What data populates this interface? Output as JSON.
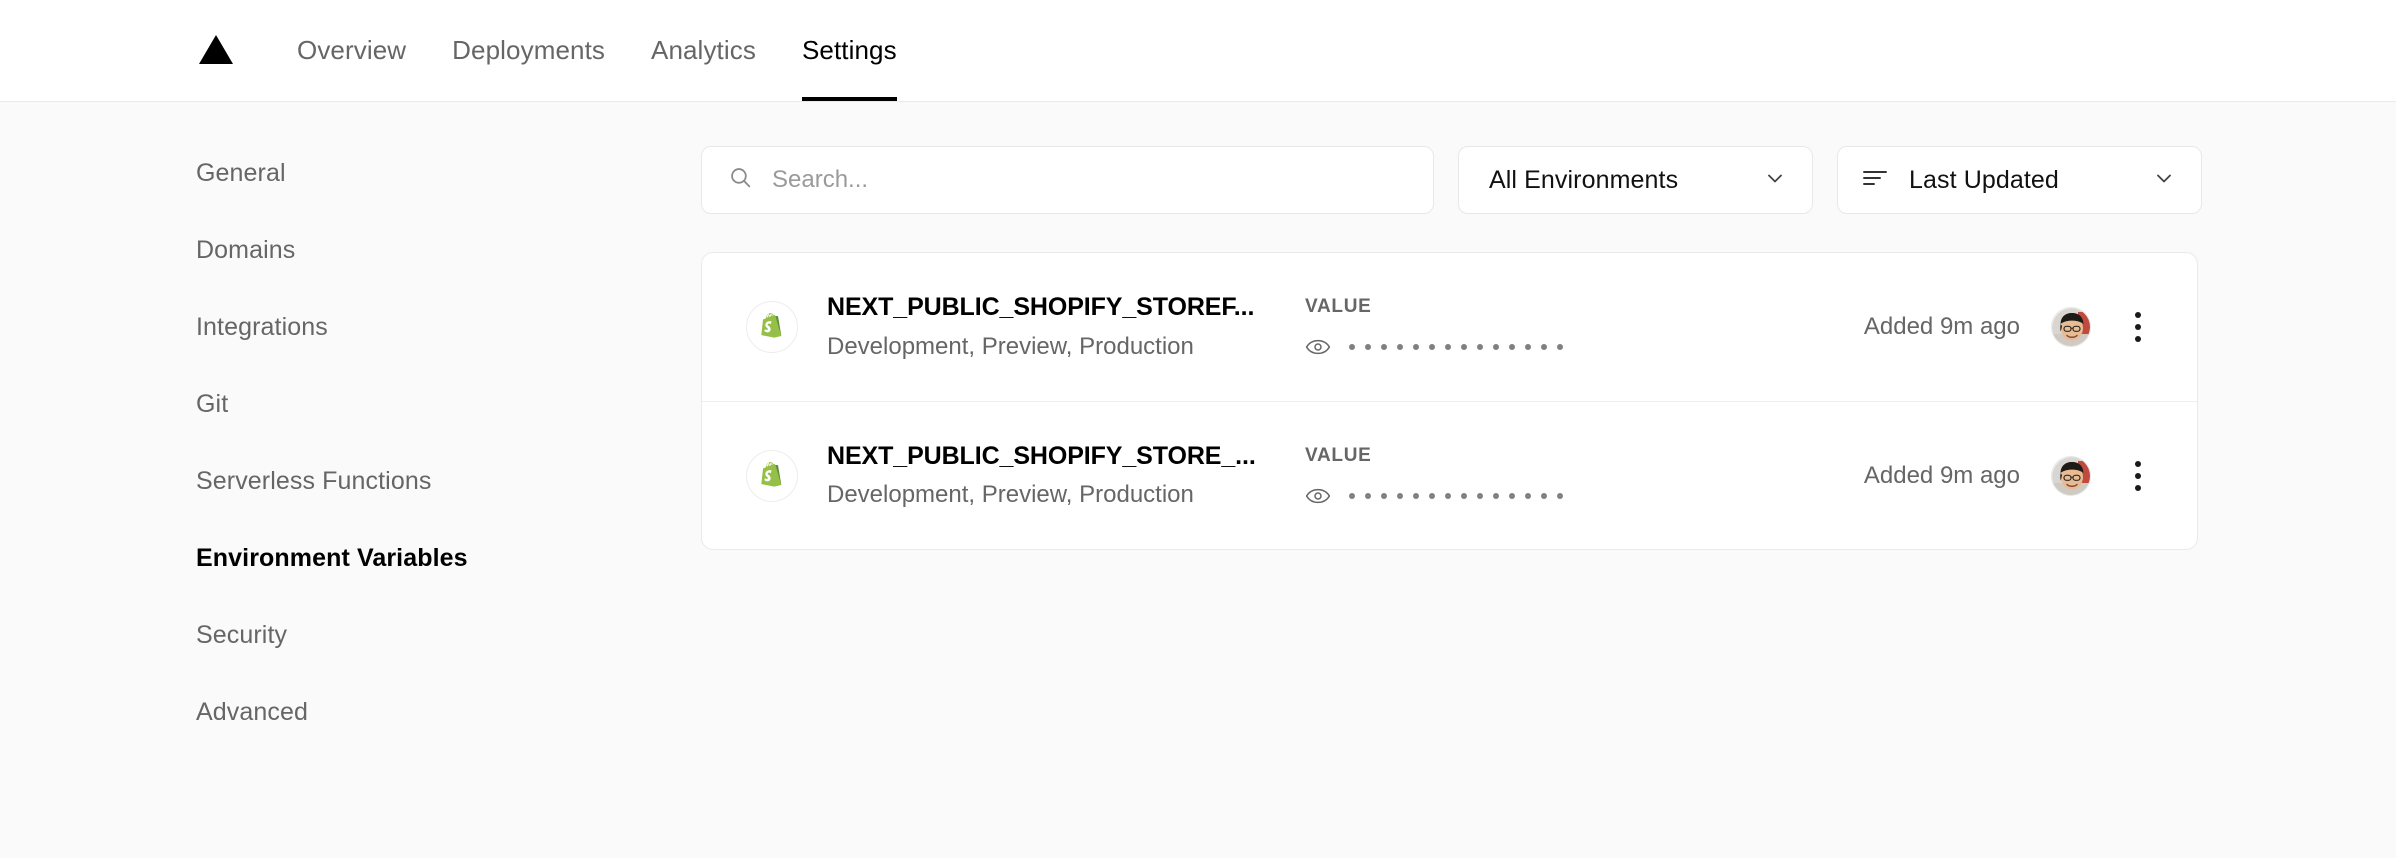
{
  "header": {
    "logo_icon": "triangle-logo-icon",
    "tabs": [
      {
        "label": "Overview",
        "active": false
      },
      {
        "label": "Deployments",
        "active": false
      },
      {
        "label": "Analytics",
        "active": false
      },
      {
        "label": "Settings",
        "active": true
      }
    ]
  },
  "sidebar": {
    "items": [
      {
        "label": "General",
        "active": false
      },
      {
        "label": "Domains",
        "active": false
      },
      {
        "label": "Integrations",
        "active": false
      },
      {
        "label": "Git",
        "active": false
      },
      {
        "label": "Serverless Functions",
        "active": false
      },
      {
        "label": "Environment Variables",
        "active": true
      },
      {
        "label": "Security",
        "active": false
      },
      {
        "label": "Advanced",
        "active": false
      }
    ]
  },
  "toolbar": {
    "search": {
      "placeholder": "Search...",
      "value": "",
      "icon": "search-icon"
    },
    "environment_filter": {
      "selected": "All Environments",
      "icon": "chevron-down-icon"
    },
    "sort": {
      "selected": "Last Updated",
      "leading_icon": "sort-lines-icon",
      "trailing_icon": "chevron-down-icon"
    }
  },
  "env_vars": {
    "value_column_header": "VALUE",
    "masked_dot_count": 14,
    "rows": [
      {
        "source_icon": "shopify-icon",
        "key": "NEXT_PUBLIC_SHOPIFY_STOREF...",
        "targets": "Development, Preview, Production",
        "value_header": "VALUE",
        "reveal_icon": "eye-icon",
        "added": "Added 9m ago",
        "avatar": "user-avatar",
        "menu_icon": "kebab-menu-icon"
      },
      {
        "source_icon": "shopify-icon",
        "key": "NEXT_PUBLIC_SHOPIFY_STORE_...",
        "targets": "Development, Preview, Production",
        "value_header": "VALUE",
        "reveal_icon": "eye-icon",
        "added": "Added 9m ago",
        "avatar": "user-avatar",
        "menu_icon": "kebab-menu-icon"
      }
    ]
  },
  "colors": {
    "page_background": "#fafafa",
    "surface": "#ffffff",
    "border": "#eaeaea",
    "text_primary": "#000000",
    "text_secondary": "#666666",
    "shopify_green": "#95bf47",
    "accent_underline": "#000000"
  }
}
